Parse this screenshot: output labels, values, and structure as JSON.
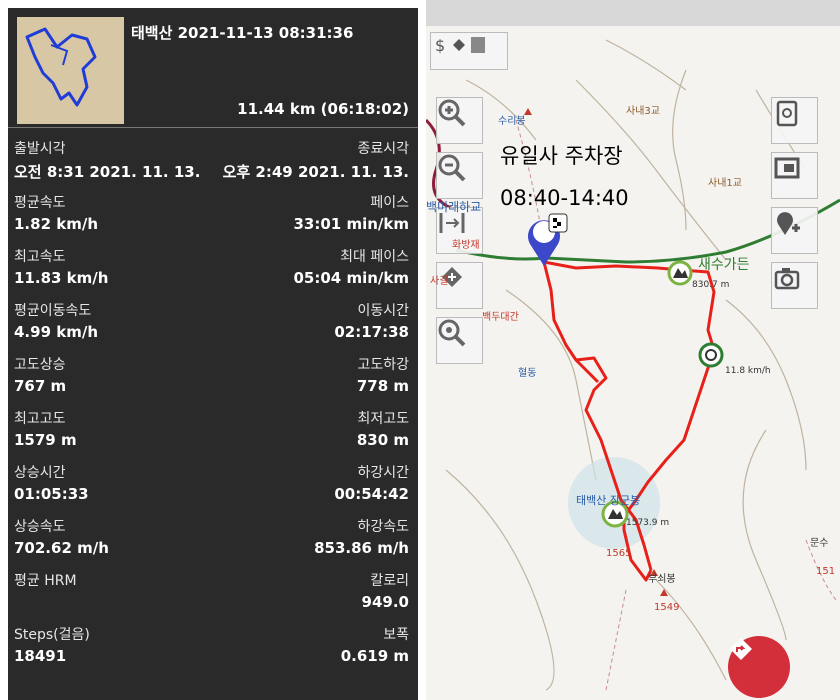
{
  "track": {
    "title": "태백산 2021-11-13 08:31:36",
    "summary": "11.44 km (06:18:02)"
  },
  "stats": [
    {
      "label_left": "출발시각",
      "label_right": "종료시각",
      "value_left": "오전 8:31 2021. 11. 13.",
      "value_right": "오후 2:49 2021. 11. 13."
    },
    {
      "label_left": "평균속도",
      "label_right": "페이스",
      "value_left": "1.82 km/h",
      "value_right": "33:01 min/km"
    },
    {
      "label_left": "최고속도",
      "label_right": "최대 페이스",
      "value_left": "11.83 km/h",
      "value_right": "05:04 min/km"
    },
    {
      "label_left": "평균이동속도",
      "label_right": "이동시간",
      "value_left": "4.99 km/h",
      "value_right": "02:17:38"
    },
    {
      "label_left": "고도상승",
      "label_right": "고도하강",
      "value_left": "767 m",
      "value_right": "778 m"
    },
    {
      "label_left": "최고고도",
      "label_right": "최저고도",
      "value_left": "1579 m",
      "value_right": "830 m"
    },
    {
      "label_left": "상승시간",
      "label_right": "하강시간",
      "value_left": "01:05:33",
      "value_right": "00:54:42"
    },
    {
      "label_left": "상승속도",
      "label_right": "하강속도",
      "value_left": "702.62 m/h",
      "value_right": "853.86 m/h"
    },
    {
      "label_left": "평균 HRM",
      "label_right": "칼로리",
      "value_left": "",
      "value_right": "949.0"
    },
    {
      "label_left": "Steps(걸음)",
      "label_right": "보폭",
      "value_left": "18491",
      "value_right": "0.619 m"
    }
  ],
  "map": {
    "annotation_place": "유일사 주차장",
    "annotation_time": "08:40-14:40",
    "labels": {
      "suribong": "수리봉",
      "sanae3": "사내3교",
      "sanae1": "사내1교",
      "baekmi": "백미래하교",
      "hwabang": "화방재",
      "sagil": "사길",
      "baekdu": "백두대간",
      "saesu": "새수가든",
      "hyeoldong": "혈동",
      "taebaek": "태백산 장군봉",
      "peak_1565": "1565",
      "bushoebong": "부쇠봉",
      "peak_1549": "1549",
      "munsu": "문수",
      "peak_151": "151",
      "speed_label": "11.8 km/h",
      "elev_1": "830.7 m",
      "elev_2": "1573.9 m"
    }
  },
  "colors": {
    "panel_bg": "#2a2a2a",
    "route": "#e8201a",
    "fab": "#d32f3a",
    "road": "#2e7d32"
  }
}
